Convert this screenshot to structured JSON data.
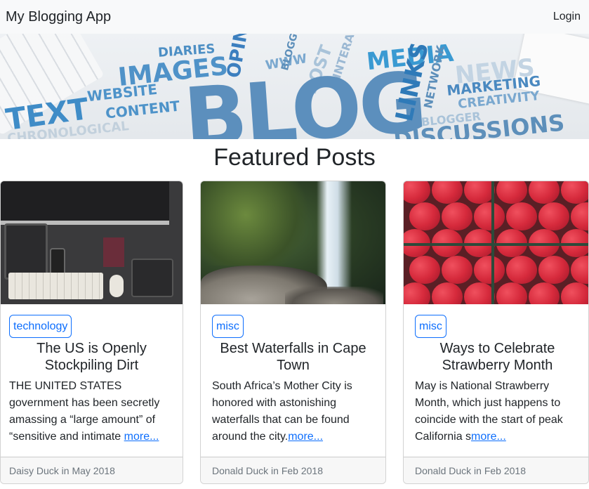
{
  "navbar": {
    "brand": "My Blogging App",
    "login_label": "Login"
  },
  "hero": {
    "words": [
      "DIARIES",
      "OPINION",
      "IMAGES",
      "WWW",
      "BLOGGING",
      "POST",
      "INTERACT",
      "MEDIA",
      "NEWS",
      "TEXT",
      "WEBSITE",
      "CONTENT",
      "BLOG",
      "LINKS",
      "NETWORK",
      "MARKETING",
      "CREATIVITY",
      "CHRONOLOGICAL",
      "BLOGGER",
      "DISCUSSIONS"
    ]
  },
  "section_title": "Featured Posts",
  "posts": [
    {
      "tag": "technology",
      "title": "The US is Openly Stockpiling Dirt",
      "excerpt": "THE UNITED STATES government has been secretly amassing a “large amount” of “sensitive and intimate ",
      "more": "more...",
      "footer": "Daisy Duck in May 2018"
    },
    {
      "tag": "misc",
      "title": "Best Waterfalls in Cape Town",
      "excerpt": "South Africa’s Mother City is honored with astonishing waterfalls that can be found around the city.",
      "more": "more...",
      "footer": "Donald Duck in Feb 2018"
    },
    {
      "tag": "misc",
      "title": "Ways to Celebrate Strawberry Month",
      "excerpt": "May is National Strawberry Month, which just happens to coincide with the start of peak California s",
      "more": "more...",
      "footer": "Donald Duck in Feb 2018"
    }
  ]
}
